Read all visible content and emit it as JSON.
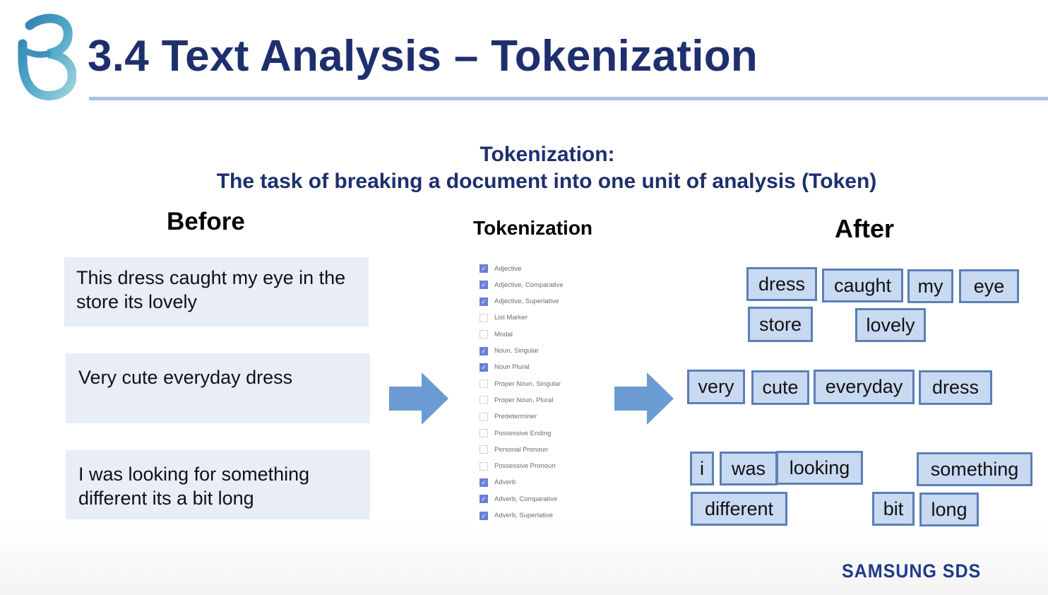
{
  "slide": {
    "title": "3.4 Text Analysis – Tokenization",
    "subtitle_line1": "Tokenization:",
    "subtitle_line2": "The task of breaking a document into one unit of analysis (Token)",
    "brand": "SAMSUNG SDS"
  },
  "columns": {
    "before": "Before",
    "tokenization": "Tokenization",
    "after": "After"
  },
  "sentences": [
    "This dress caught my eye in the store its lovely",
    "Very cute everyday dress",
    "I was looking for something different its a bit long"
  ],
  "pos_tags": [
    {
      "label": "Adjective",
      "checked": true
    },
    {
      "label": "Adjective, Comparative",
      "checked": true
    },
    {
      "label": "Adjective, Superlative",
      "checked": true
    },
    {
      "label": "List Marker",
      "checked": false
    },
    {
      "label": "Modal",
      "checked": false
    },
    {
      "label": "Noun, Singular",
      "checked": true
    },
    {
      "label": "Noun Plural",
      "checked": true
    },
    {
      "label": "Proper Noun, Singular",
      "checked": false
    },
    {
      "label": "Proper Noun, Plural",
      "checked": false
    },
    {
      "label": "Predeterminer",
      "checked": false
    },
    {
      "label": "Possessive Ending",
      "checked": false
    },
    {
      "label": "Personal Pronoun",
      "checked": false
    },
    {
      "label": "Possessive Pronoun",
      "checked": false
    },
    {
      "label": "Adverb",
      "checked": true
    },
    {
      "label": "Adverb, Comparative",
      "checked": true
    },
    {
      "label": "Adverb, Superlative",
      "checked": true
    }
  ],
  "tokens": {
    "group1": [
      "dress",
      "caught",
      "my",
      "eye",
      "store",
      "lovely"
    ],
    "group2": [
      "very",
      "cute",
      "everyday",
      "dress"
    ],
    "group3": [
      "i",
      "was",
      "looking",
      "something",
      "different",
      "bit",
      "long"
    ]
  },
  "colors": {
    "title": "#1e2f6e",
    "sentence_bg": "#e8edf8",
    "token_fill": "#c8d9f2",
    "token_border": "#5b7fb7",
    "arrow": "#6b9bd2",
    "checkbox_on": "#6a7fd8"
  },
  "icons": {
    "logo": "b-logo-icon",
    "arrow": "right-arrow-icon",
    "check": "check-icon"
  }
}
